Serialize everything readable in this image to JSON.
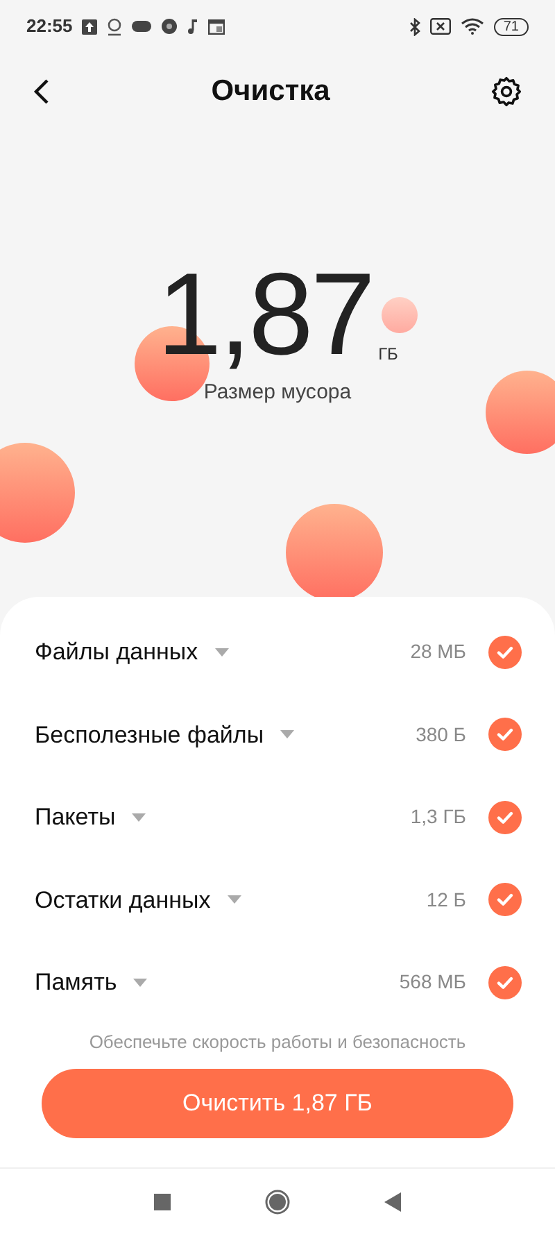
{
  "status_bar": {
    "time": "22:55",
    "battery": "71"
  },
  "header": {
    "title": "Очистка"
  },
  "summary": {
    "value": "1,87",
    "unit": "ГБ",
    "caption": "Размер мусора"
  },
  "items": [
    {
      "label": "Файлы данных",
      "size": "28 МБ",
      "checked": true
    },
    {
      "label": "Бесполезные файлы",
      "size": "380 Б",
      "checked": true
    },
    {
      "label": "Пакеты",
      "size": "1,3 ГБ",
      "checked": true
    },
    {
      "label": "Остатки данных",
      "size": "12 Б",
      "checked": true
    },
    {
      "label": "Память",
      "size": "568 МБ",
      "checked": true
    }
  ],
  "hint": "Обеспечьте скорость работы и безопасность",
  "clean_button": "Очистить 1,87 ГБ"
}
